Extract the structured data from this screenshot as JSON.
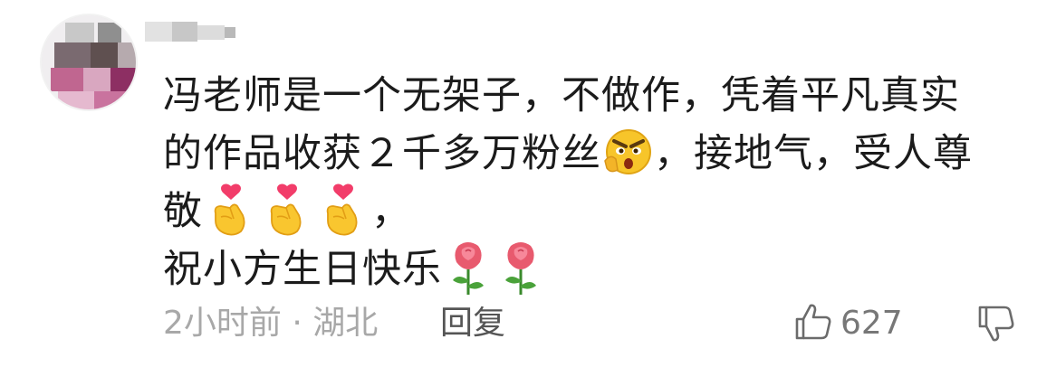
{
  "comment": {
    "avatar_icon": "avatar-blurred",
    "username_icon": "username-blurred",
    "lines": [
      {
        "text": "冯老师是一个无架子，不做作，凭着平凡真实"
      },
      {
        "text_a": "的作品收获２千多万粉丝",
        "emoji": "smirk-face-icon",
        "text_b": "，接地气，受人尊"
      },
      {
        "text_a": "敬",
        "emojis": [
          "finger-heart-icon",
          "finger-heart-icon",
          "finger-heart-icon"
        ],
        "text_b": "，"
      },
      {
        "text_a": "祝小方生日快乐",
        "emojis": [
          "rose-icon",
          "rose-icon"
        ]
      }
    ],
    "time": "2小时前",
    "separator": "·",
    "location": "湖北",
    "reply_label": "回复",
    "like_icon": "thumbs-up-icon",
    "like_count": "627",
    "dislike_icon": "thumbs-down-icon"
  }
}
